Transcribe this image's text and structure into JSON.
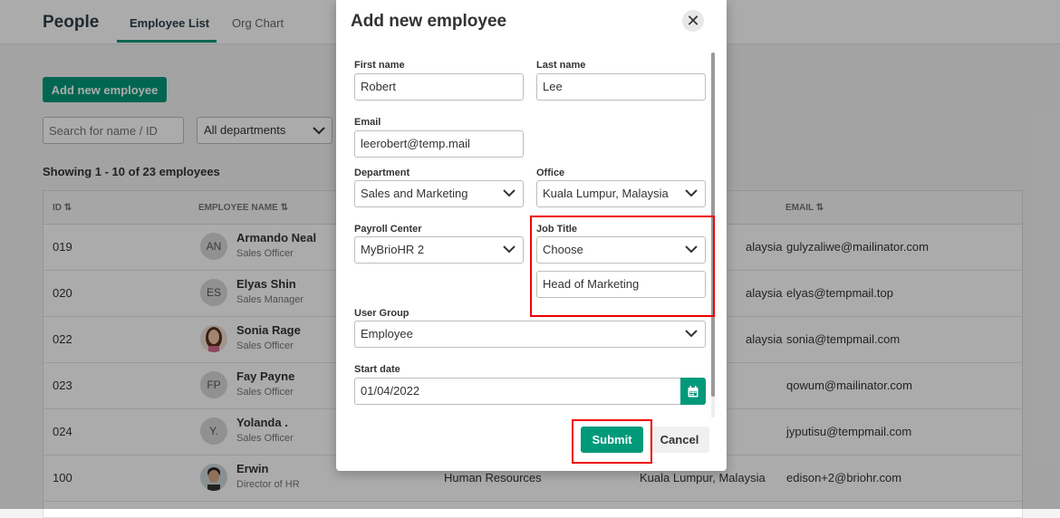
{
  "header": {
    "title": "People",
    "tabs": [
      {
        "label": "Employee List",
        "active": true
      },
      {
        "label": "Org Chart",
        "active": false
      }
    ]
  },
  "toolbar": {
    "add_label": "Add new employee",
    "search_placeholder": "Search for name / ID",
    "department_filter": "All departments"
  },
  "showing_text": "Showing 1 - 10 of 23 employees",
  "table": {
    "columns": {
      "id": "ID",
      "name": "EMPLOYEE NAME",
      "email": "EMAIL"
    },
    "rows": [
      {
        "id": "019",
        "initials": "AN",
        "name": "Armando Neal",
        "role": "Sales Officer",
        "office": "alaysia",
        "email": "gulyzaliwe@mailinator.com",
        "avatar": "initials"
      },
      {
        "id": "020",
        "initials": "ES",
        "name": "Elyas Shin",
        "role": "Sales Manager",
        "office": "alaysia",
        "email": "elyas@tempmail.top",
        "avatar": "initials"
      },
      {
        "id": "022",
        "initials": "",
        "name": "Sonia Rage",
        "role": "Sales Officer",
        "office": "alaysia",
        "email": "sonia@tempmail.com",
        "avatar": "photo"
      },
      {
        "id": "023",
        "initials": "FP",
        "name": "Fay Payne",
        "role": "Sales Officer",
        "office": "",
        "email": "qowum@mailinator.com",
        "avatar": "initials"
      },
      {
        "id": "024",
        "initials": "Y.",
        "name": "Yolanda .",
        "role": "Sales Officer",
        "office": "",
        "email": "jyputisu@tempmail.com",
        "avatar": "initials"
      },
      {
        "id": "100",
        "initials": "",
        "name": "Erwin",
        "role": "Director of HR",
        "department": "Human Resources",
        "office": "Kuala Lumpur, Malaysia",
        "email": "edison+2@briohr.com",
        "avatar": "photo"
      }
    ]
  },
  "modal": {
    "title": "Add new employee",
    "first_name": {
      "label": "First name",
      "value": "Robert"
    },
    "last_name": {
      "label": "Last name",
      "value": "Lee"
    },
    "email": {
      "label": "Email",
      "value": "leerobert@temp.mail"
    },
    "department": {
      "label": "Department",
      "value": "Sales and Marketing"
    },
    "office": {
      "label": "Office",
      "value": "Kuala Lumpur, Malaysia"
    },
    "payroll_center": {
      "label": "Payroll Center",
      "value": "MyBrioHR 2"
    },
    "job_title": {
      "label": "Job Title",
      "select_value": "Choose",
      "input_value": "Head of Marketing"
    },
    "user_group": {
      "label": "User Group",
      "value": "Employee"
    },
    "start_date": {
      "label": "Start date",
      "value": "01/04/2022"
    },
    "submit_label": "Submit",
    "cancel_label": "Cancel"
  },
  "colors": {
    "accent": "#00997a",
    "highlight": "#e00000"
  }
}
